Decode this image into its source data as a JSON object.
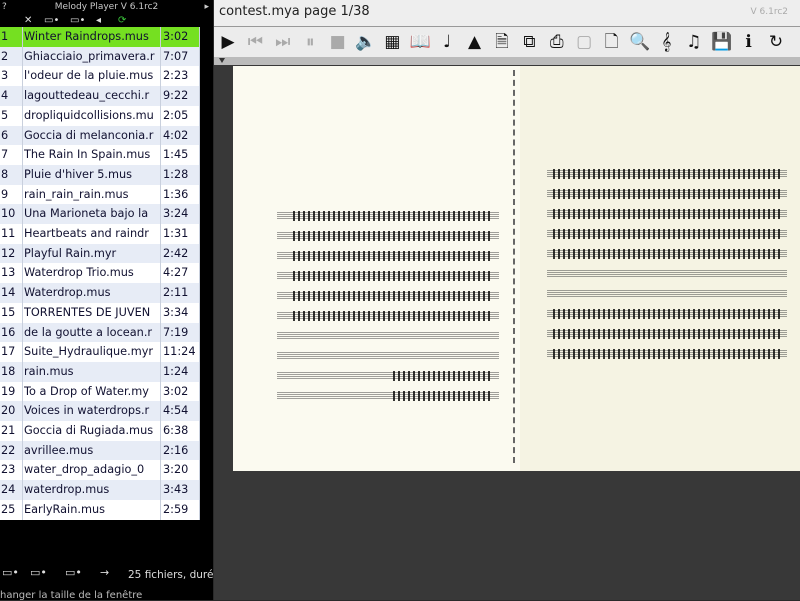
{
  "player": {
    "title": "Melody Player V 6.1rc2",
    "help_mark": "?",
    "toolbar_icons": [
      "close-icon",
      "folder-add-icon",
      "folder-remove-icon",
      "back-icon",
      "sync-icon"
    ],
    "toolbar_glyphs": [
      "✕",
      "▭•",
      "▭•",
      "◂",
      "⟳"
    ]
  },
  "playlist": {
    "selected_index": 0,
    "items": [
      {
        "num": "1",
        "name": "Winter Raindrops.mus",
        "dur": "3:02"
      },
      {
        "num": "2",
        "name": "Ghiacciaio_primavera.r",
        "dur": "7:07"
      },
      {
        "num": "3",
        "name": "l'odeur de la pluie.mus",
        "dur": "2:23"
      },
      {
        "num": "4",
        "name": "lagouttedeau_cecchi.r",
        "dur": "9:22"
      },
      {
        "num": "5",
        "name": "dropliquidcollisions.mu",
        "dur": "2:05"
      },
      {
        "num": "6",
        "name": "Goccia di melanconia.r",
        "dur": "4:02"
      },
      {
        "num": "7",
        "name": "The Rain In Spain.mus",
        "dur": "1:45"
      },
      {
        "num": "8",
        "name": "Pluie d'hiver 5.mus",
        "dur": "1:28"
      },
      {
        "num": "9",
        "name": "rain_rain_rain.mus",
        "dur": "1:36"
      },
      {
        "num": "10",
        "name": "Una Marioneta bajo la",
        "dur": "3:24"
      },
      {
        "num": "11",
        "name": "Heartbeats and raindr",
        "dur": "1:31"
      },
      {
        "num": "12",
        "name": "Playful Rain.myr",
        "dur": "2:42"
      },
      {
        "num": "13",
        "name": "Waterdrop Trio.mus",
        "dur": "4:27"
      },
      {
        "num": "14",
        "name": "Waterdrop.mus",
        "dur": "2:11"
      },
      {
        "num": "15",
        "name": "TORRENTES DE JUVEN",
        "dur": "3:34"
      },
      {
        "num": "16",
        "name": "de la goutte a locean.r",
        "dur": "7:19"
      },
      {
        "num": "17",
        "name": "Suite_Hydraulique.myr",
        "dur": "11:24"
      },
      {
        "num": "18",
        "name": "rain.mus",
        "dur": "1:24"
      },
      {
        "num": "19",
        "name": "To a Drop of Water.my",
        "dur": "3:02"
      },
      {
        "num": "20",
        "name": "Voices in waterdrops.r",
        "dur": "4:54"
      },
      {
        "num": "21",
        "name": "Goccia di Rugiada.mus",
        "dur": "6:38"
      },
      {
        "num": "22",
        "name": "avrillee.mus",
        "dur": "2:16"
      },
      {
        "num": "23",
        "name": "water_drop_adagio_0",
        "dur": "3:20"
      },
      {
        "num": "24",
        "name": "waterdrop.mus",
        "dur": "3:43"
      },
      {
        "num": "25",
        "name": "EarlyRain.mus",
        "dur": "2:59"
      }
    ],
    "status": "25 fichiers, duré",
    "hint": "hanger la taille de la fenêtre",
    "bottom_icons": [
      "add-file-icon",
      "add-folder-icon",
      "remove-file-icon",
      "arrow-right-icon"
    ],
    "bottom_glyphs": [
      "▭•",
      "▭•",
      "▭•",
      "→"
    ]
  },
  "score_window": {
    "title": "contest.mya page 1/38",
    "version_tag": "V 6.1rc2",
    "toolbar": [
      {
        "icon": "play-icon",
        "glyph": "▶",
        "dim": false
      },
      {
        "icon": "rewind-icon",
        "glyph": "⏮",
        "dim": true
      },
      {
        "icon": "forward-icon",
        "glyph": "⏭",
        "dim": true
      },
      {
        "icon": "pause-icon",
        "glyph": "⏸",
        "dim": true
      },
      {
        "icon": "stop-icon",
        "glyph": "■",
        "dim": true
      },
      {
        "icon": "speaker-icon",
        "glyph": "🔈",
        "dim": false
      },
      {
        "icon": "keyboard-icon",
        "glyph": "▦",
        "dim": false
      },
      {
        "icon": "book-icon",
        "glyph": "📖",
        "dim": false
      },
      {
        "icon": "note-icon",
        "glyph": "♩",
        "dim": false
      },
      {
        "icon": "metronome-icon",
        "glyph": "▲",
        "dim": false
      },
      {
        "icon": "page-icon",
        "glyph": "🗎",
        "dim": false
      },
      {
        "icon": "copy-icon",
        "glyph": "⧉",
        "dim": false
      },
      {
        "icon": "print-icon",
        "glyph": "⎙",
        "dim": false
      },
      {
        "icon": "blank-icon",
        "glyph": "▢",
        "dim": true
      },
      {
        "icon": "pdf-icon",
        "glyph": "🗋",
        "dim": false
      },
      {
        "icon": "zoom-icon",
        "glyph": "🔍",
        "dim": false
      },
      {
        "icon": "treble-clef-icon",
        "glyph": "𝄞",
        "dim": false
      },
      {
        "icon": "notes-icon",
        "glyph": "♫",
        "dim": false
      },
      {
        "icon": "save-icon",
        "glyph": "💾",
        "dim": false
      },
      {
        "icon": "info-icon",
        "glyph": "ℹ",
        "dim": false
      },
      {
        "icon": "refresh-icon",
        "glyph": "↻",
        "dim": false
      }
    ]
  }
}
